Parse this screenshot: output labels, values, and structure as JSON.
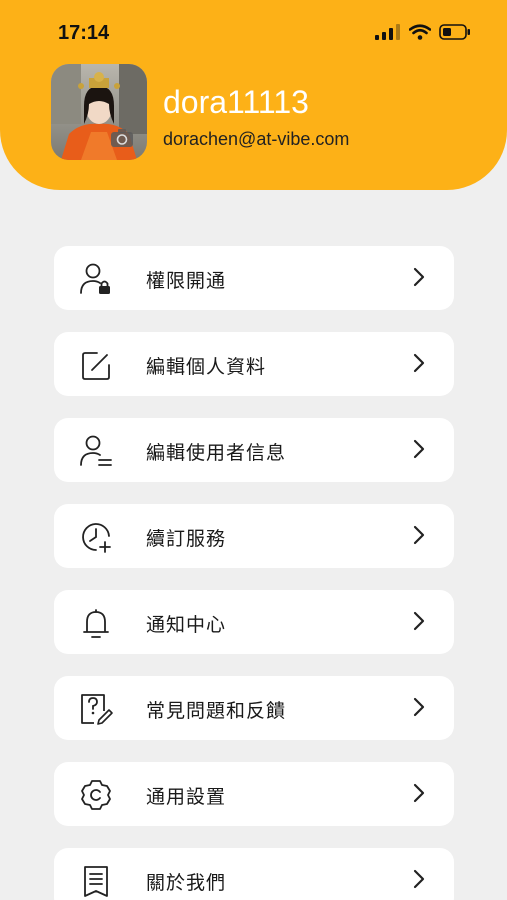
{
  "status_bar": {
    "time": "17:14"
  },
  "profile": {
    "username": "dora11113",
    "email": "dorachen@at-vibe.com"
  },
  "colors": {
    "header_bg": "#fdb117",
    "page_bg": "#efefef",
    "card_bg": "#ffffff"
  },
  "menu": {
    "items": [
      {
        "label": "權限開通",
        "icon": "user-lock-icon"
      },
      {
        "label": "編輯個人資料",
        "icon": "edit-icon"
      },
      {
        "label": "編輯使用者信息",
        "icon": "user-lines-icon"
      },
      {
        "label": "續訂服務",
        "icon": "clock-plus-icon"
      },
      {
        "label": "通知中心",
        "icon": "bell-icon"
      },
      {
        "label": "常見問題和反饋",
        "icon": "question-edit-icon"
      },
      {
        "label": "通用設置",
        "icon": "gear-icon"
      },
      {
        "label": "關於我們",
        "icon": "document-icon"
      }
    ]
  }
}
